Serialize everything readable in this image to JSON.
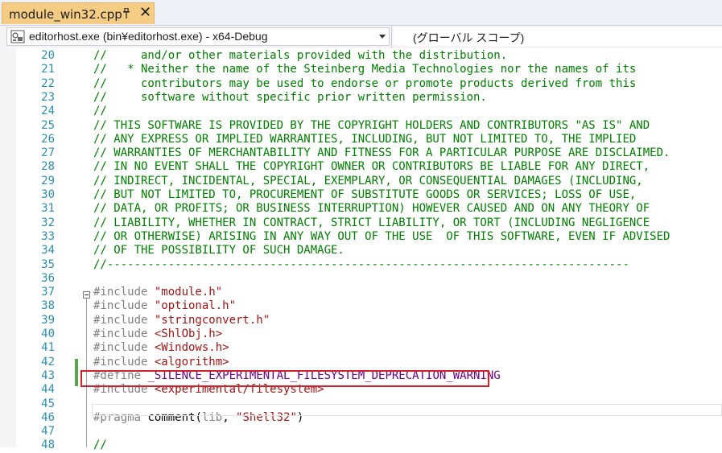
{
  "tab": {
    "title": "module_win32.cpp",
    "pin_icon": "pin-icon",
    "close_glyph": "✕"
  },
  "navbar": {
    "project": "editorhost.exe (bin¥editorhost.exe) - x64-Debug",
    "scope": "(グローバル スコープ)"
  },
  "colors": {
    "comment": "#008000",
    "preprocessor": "#808080",
    "string": "#a31515",
    "macro": "#6f008a",
    "line_number": "#2b91af",
    "highlight_box": "#d0202a",
    "tab_active": "#f5cc84"
  },
  "lines": [
    {
      "n": "20",
      "parts": [
        {
          "t": "//     and/or other materials provided with the distribution.",
          "k": "comment"
        }
      ]
    },
    {
      "n": "21",
      "parts": [
        {
          "t": "//   * Neither the name of the Steinberg Media Technologies nor the names of its",
          "k": "comment"
        }
      ]
    },
    {
      "n": "22",
      "parts": [
        {
          "t": "//     contributors may be used to endorse or promote products derived from this",
          "k": "comment"
        }
      ]
    },
    {
      "n": "23",
      "parts": [
        {
          "t": "//     software without specific prior written permission.",
          "k": "comment"
        }
      ]
    },
    {
      "n": "24",
      "parts": [
        {
          "t": "//",
          "k": "comment"
        }
      ]
    },
    {
      "n": "25",
      "parts": [
        {
          "t": "// THIS SOFTWARE IS PROVIDED BY THE COPYRIGHT HOLDERS AND CONTRIBUTORS \"AS IS\" AND",
          "k": "comment"
        }
      ]
    },
    {
      "n": "26",
      "parts": [
        {
          "t": "// ANY EXPRESS OR IMPLIED WARRANTIES, INCLUDING, BUT NOT LIMITED TO, THE IMPLIED",
          "k": "comment"
        }
      ]
    },
    {
      "n": "27",
      "parts": [
        {
          "t": "// WARRANTIES OF MERCHANTABILITY AND FITNESS FOR A PARTICULAR PURPOSE ARE DISCLAIMED.",
          "k": "comment"
        }
      ]
    },
    {
      "n": "28",
      "parts": [
        {
          "t": "// IN NO EVENT SHALL THE COPYRIGHT OWNER OR CONTRIBUTORS BE LIABLE FOR ANY DIRECT,",
          "k": "comment"
        }
      ]
    },
    {
      "n": "29",
      "parts": [
        {
          "t": "// INDIRECT, INCIDENTAL, SPECIAL, EXEMPLARY, OR CONSEQUENTIAL DAMAGES (INCLUDING,",
          "k": "comment"
        }
      ]
    },
    {
      "n": "30",
      "parts": [
        {
          "t": "// BUT NOT LIMITED TO, PROCUREMENT OF SUBSTITUTE GOODS OR SERVICES; LOSS OF USE,",
          "k": "comment"
        }
      ]
    },
    {
      "n": "31",
      "parts": [
        {
          "t": "// DATA, OR PROFITS; OR BUSINESS INTERRUPTION) HOWEVER CAUSED AND ON ANY THEORY OF",
          "k": "comment"
        }
      ]
    },
    {
      "n": "32",
      "parts": [
        {
          "t": "// LIABILITY, WHETHER IN CONTRACT, STRICT LIABILITY, OR TORT (INCLUDING NEGLIGENCE",
          "k": "comment"
        }
      ]
    },
    {
      "n": "33",
      "parts": [
        {
          "t": "// OR OTHERWISE) ARISING IN ANY WAY OUT OF THE USE  OF THIS SOFTWARE, EVEN IF ADVISED",
          "k": "comment"
        }
      ]
    },
    {
      "n": "34",
      "parts": [
        {
          "t": "// OF THE POSSIBILITY OF SUCH DAMAGE.",
          "k": "comment"
        }
      ]
    },
    {
      "n": "35",
      "parts": [
        {
          "t": "//-----------------------------------------------------------------------------",
          "k": "comment"
        }
      ]
    },
    {
      "n": "36",
      "parts": []
    },
    {
      "n": "37",
      "parts": [
        {
          "t": "#include ",
          "k": "pre"
        },
        {
          "t": "\"module.h\"",
          "k": "str"
        }
      ]
    },
    {
      "n": "38",
      "parts": [
        {
          "t": "#include ",
          "k": "pre"
        },
        {
          "t": "\"optional.h\"",
          "k": "str"
        }
      ]
    },
    {
      "n": "39",
      "parts": [
        {
          "t": "#include ",
          "k": "pre"
        },
        {
          "t": "\"stringconvert.h\"",
          "k": "str"
        }
      ]
    },
    {
      "n": "40",
      "parts": [
        {
          "t": "#include ",
          "k": "pre"
        },
        {
          "t": "<ShlObj.h>",
          "k": "str"
        }
      ]
    },
    {
      "n": "41",
      "parts": [
        {
          "t": "#include ",
          "k": "pre"
        },
        {
          "t": "<Windows.h>",
          "k": "str"
        }
      ]
    },
    {
      "n": "42",
      "parts": [
        {
          "t": "#include ",
          "k": "pre"
        },
        {
          "t": "<algorithm>",
          "k": "str"
        }
      ]
    },
    {
      "n": "43",
      "parts": [
        {
          "t": "#define ",
          "k": "pre"
        },
        {
          "t": "_SILENCE_EXPERIMENTAL_FILESYSTEM_DEPRECATION_WARNING",
          "k": "macro"
        }
      ]
    },
    {
      "n": "44",
      "parts": [
        {
          "t": "#include ",
          "k": "pre"
        },
        {
          "t": "<experimental/filesystem>",
          "k": "str"
        }
      ]
    },
    {
      "n": "45",
      "parts": []
    },
    {
      "n": "46",
      "parts": [
        {
          "t": "#pragma ",
          "k": "pre"
        },
        {
          "t": "comment",
          "k": "plain"
        },
        {
          "t": "(",
          "k": "plain"
        },
        {
          "t": "lib",
          "k": "pre"
        },
        {
          "t": ", ",
          "k": "plain"
        },
        {
          "t": "\"Shell32\"",
          "k": "str"
        },
        {
          "t": ")",
          "k": "plain"
        }
      ]
    },
    {
      "n": "47",
      "parts": []
    },
    {
      "n": "48",
      "parts": [
        {
          "t": "//",
          "k": "comment"
        }
      ]
    }
  ]
}
